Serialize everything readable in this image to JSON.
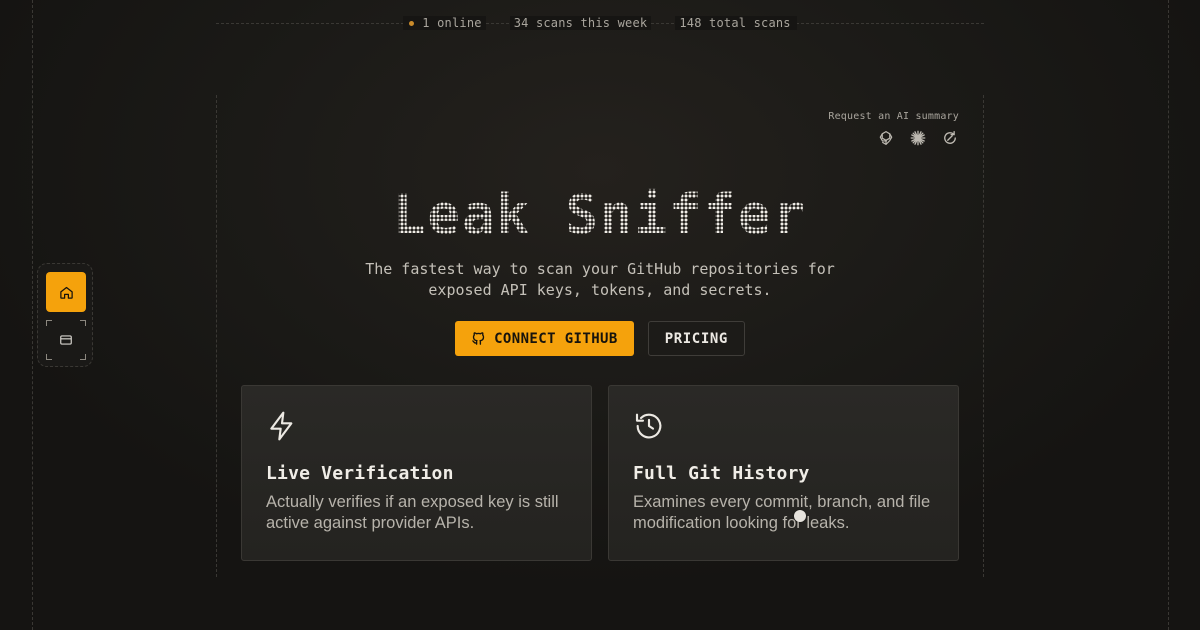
{
  "stats": {
    "online": "1 online",
    "week": "34 scans this week",
    "total": "148 total scans"
  },
  "ai_summary": {
    "label": "Request an AI summary",
    "icons": [
      "chatgpt-icon",
      "claude-icon",
      "perplexity-icon"
    ]
  },
  "hero": {
    "title": "Leak Sniffer",
    "subtitle_line1": "The fastest way to scan your GitHub repositories for",
    "subtitle_line2": "exposed API keys, tokens, and secrets."
  },
  "cta": {
    "connect_label": "CONNECT GITHUB",
    "pricing_label": "PRICING"
  },
  "features": [
    {
      "icon": "lightning-icon",
      "title": "Live Verification",
      "desc": "Actually verifies if an exposed key is still active against provider APIs."
    },
    {
      "icon": "history-icon",
      "title": "Full Git History",
      "desc": "Examines every commit, branch, and file modification looking for leaks."
    }
  ],
  "side_nav": {
    "items": [
      "home-icon",
      "pricing-card-icon"
    ]
  },
  "colors": {
    "accent": "#f5a20c",
    "background": "#161513",
    "card": "#2a2926",
    "online_dot": "#c98a2a"
  }
}
